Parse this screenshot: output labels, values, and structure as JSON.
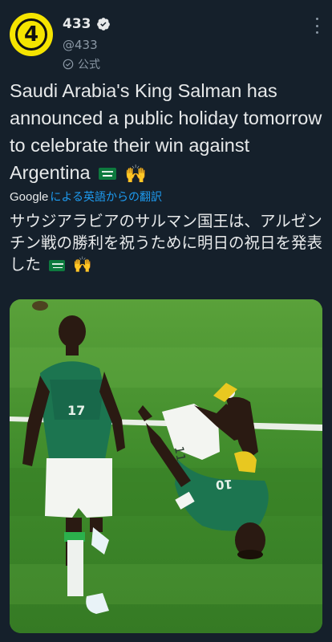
{
  "account": {
    "avatar_text": "4",
    "display_name": "433",
    "handle": "@433",
    "official_label": "公式"
  },
  "tweet": {
    "text": "Saudi Arabia's King Salman has announced a public holiday tomorrow to celebrate their win against Argentina",
    "emoji_hands": "🙌"
  },
  "translation": {
    "google_label": "Google",
    "link_text": "による英語からの翻訳",
    "text": "サウジアラビアのサルマン国王は、アルゼンチン戦の勝利を祝うために明日の祝日を発表した"
  },
  "media": {
    "jersey_number_left": "17",
    "jersey_number_right": "10"
  },
  "colors": {
    "background": "#15202b",
    "link": "#1d9bf0",
    "secondary_text": "#8b98a5",
    "avatar_bg": "#f5e400"
  }
}
